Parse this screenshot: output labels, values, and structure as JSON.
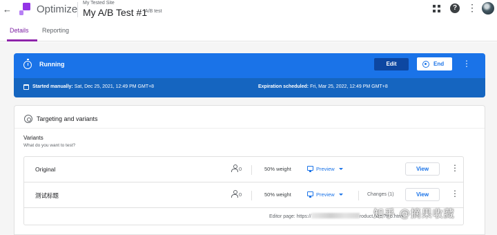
{
  "header": {
    "back_icon": "arrow-back-icon",
    "app_name": "Optimize",
    "brand_color": "#9334E6",
    "container_name": "My Tested Site",
    "experiment_name": "My A/B Test #1",
    "experiment_type": "A/B test",
    "icons": [
      "apps-grid-icon",
      "help-icon",
      "more-vert-icon",
      "avatar"
    ]
  },
  "tabs": [
    {
      "label": "Details",
      "active": true
    },
    {
      "label": "Reporting",
      "active": false
    }
  ],
  "status": {
    "label": "Running",
    "icon": "timer-icon",
    "edit_label": "Edit",
    "end_label": "End",
    "started_label": "Started manually:",
    "started_value": "Sat, Dec 25, 2021, 12:49 PM GMT+8",
    "expiration_label": "Expiration scheduled:",
    "expiration_value": "Fri, Mar 25, 2022, 12:49 PM GMT+8",
    "colors": {
      "banner": "#1A73E8",
      "banner_dark": "#1565C0",
      "edit_button": "#0D47A1"
    }
  },
  "targeting": {
    "title": "Targeting and variants",
    "variants_title": "Variants",
    "variants_subtitle": "What do you want to test?",
    "variants": [
      {
        "name": "Original",
        "visitors": "0",
        "weight": "50% weight",
        "preview_label": "Preview",
        "changes": "",
        "view_label": "View"
      },
      {
        "name": "测试标题",
        "visitors": "0",
        "weight": "50% weight",
        "preview_label": "Preview",
        "changes": "Changes (1)",
        "view_label": "View"
      }
    ],
    "editor_page_label": "Editor page: https://",
    "editor_page_suffix": "roduct.html?trio.html"
  },
  "watermark": "知乎 @摘果收藏"
}
